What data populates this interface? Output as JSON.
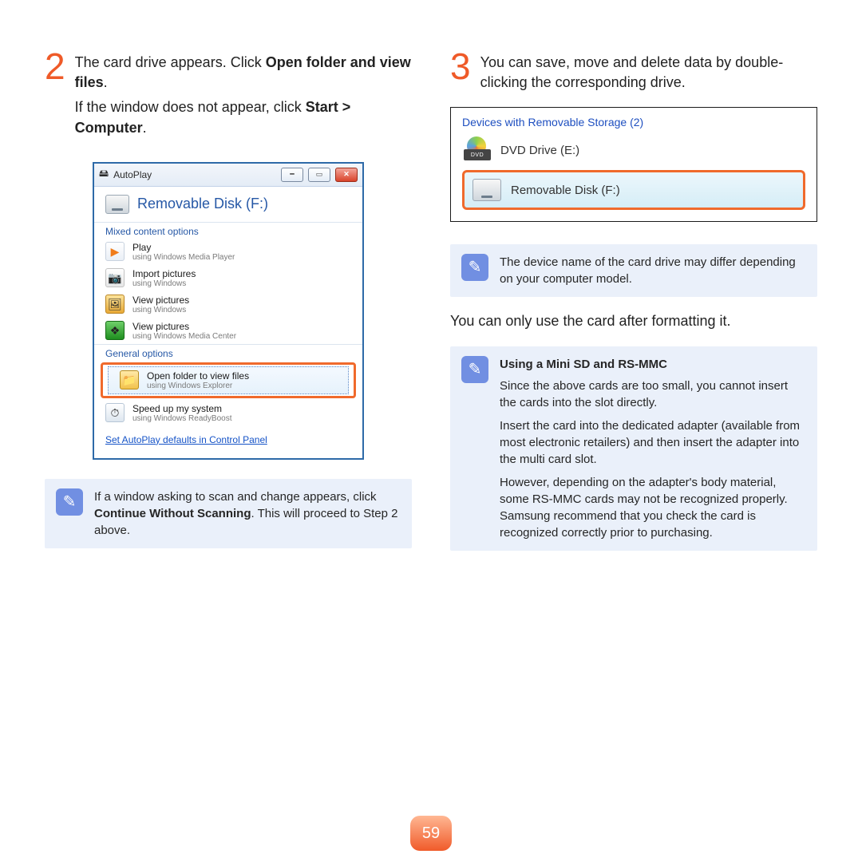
{
  "page_number": "59",
  "left": {
    "step_number": "2",
    "line1_pre": "The card drive appears. Click ",
    "line1_bold": "Open folder and view files",
    "line1_post": ".",
    "line2_pre": "If the window does not appear, click ",
    "line2_bold": "Start > Computer",
    "line2_post": ".",
    "autoplay": {
      "title": "AutoPlay",
      "header": "Removable Disk (F:)",
      "section_mixed": "Mixed content options",
      "opts": [
        {
          "t": "Play",
          "s": "using Windows Media Player"
        },
        {
          "t": "Import pictures",
          "s": "using Windows"
        },
        {
          "t": "View pictures",
          "s": "using Windows"
        },
        {
          "t": "View pictures",
          "s": "using Windows Media Center"
        }
      ],
      "section_general": "General options",
      "hl": {
        "t": "Open folder to view files",
        "s": "using Windows Explorer"
      },
      "speed": {
        "t": "Speed up my system",
        "s": "using Windows ReadyBoost"
      },
      "footer_link": "Set AutoPlay defaults in Control Panel"
    },
    "note_pre": "If a window asking to scan and change appears, click ",
    "note_bold": "Continue Without Scanning",
    "note_post": ". This will proceed to Step 2 above."
  },
  "right": {
    "step_number": "3",
    "step_text": "You can save, move and delete data by double-clicking the corresponding drive.",
    "explorer": {
      "heading": "Devices with Removable Storage (2)",
      "dvd_box": "DVD",
      "dvd": "DVD Drive (E:)",
      "removable": "Removable Disk (F:)"
    },
    "note1": "The device name of the card drive may differ depending on your computer model.",
    "after_note": "You can only use the card after formatting it.",
    "note2": {
      "title": "Using a Mini SD and RS-MMC",
      "p1": "Since the above cards are too small, you cannot insert the cards into the slot directly.",
      "p2": "Insert the card into the dedicated adapter (available from most electronic retailers) and then insert the adapter into the multi card slot.",
      "p3": "However, depending on the adapter's body material, some RS-MMC cards may not be recognized properly. Samsung recommend that you check the card is recognized correctly prior to purchasing."
    }
  }
}
